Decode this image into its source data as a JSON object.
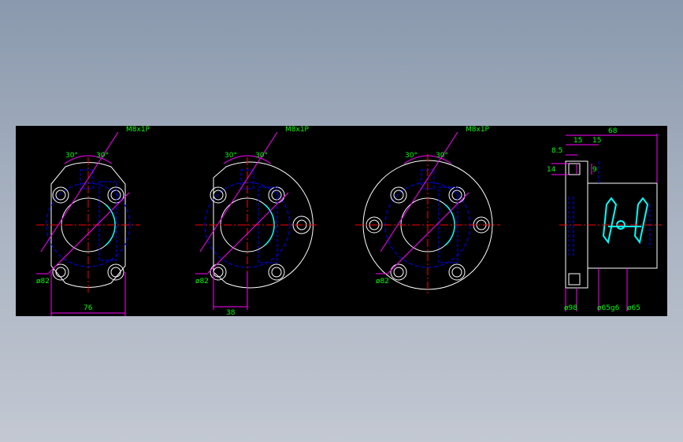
{
  "colors": {
    "canvas_background": "#000000",
    "outline": "#ffffff",
    "center_line": "#ff0000",
    "hidden_line": "#0000ff",
    "dimension_line": "#ff00ff",
    "dimension_text": "#00ff00",
    "bore_highlight": "#00ffff"
  },
  "views": [
    {
      "thread_callout": "M8x1P",
      "angle_left": "30°",
      "angle_right": "30°",
      "diameter_label": "ø82",
      "width_label": "76"
    },
    {
      "thread_callout": "M8x1P",
      "angle_left": "30°",
      "angle_right": "30°",
      "diameter_label": "ø82",
      "offset_label": "38"
    },
    {
      "thread_callout": "M8x1P",
      "angle_left": "30°",
      "angle_right": "30°",
      "diameter_label": "ø82"
    }
  ],
  "side_view": {
    "overall_length": "68",
    "flange_a": "15",
    "flange_b": "15",
    "thickness_small": "8.5",
    "height_left": "14",
    "height_right": "9",
    "dia_flange": "ø98",
    "dia_fit": "ø65g6",
    "dia_body": "ø65"
  }
}
